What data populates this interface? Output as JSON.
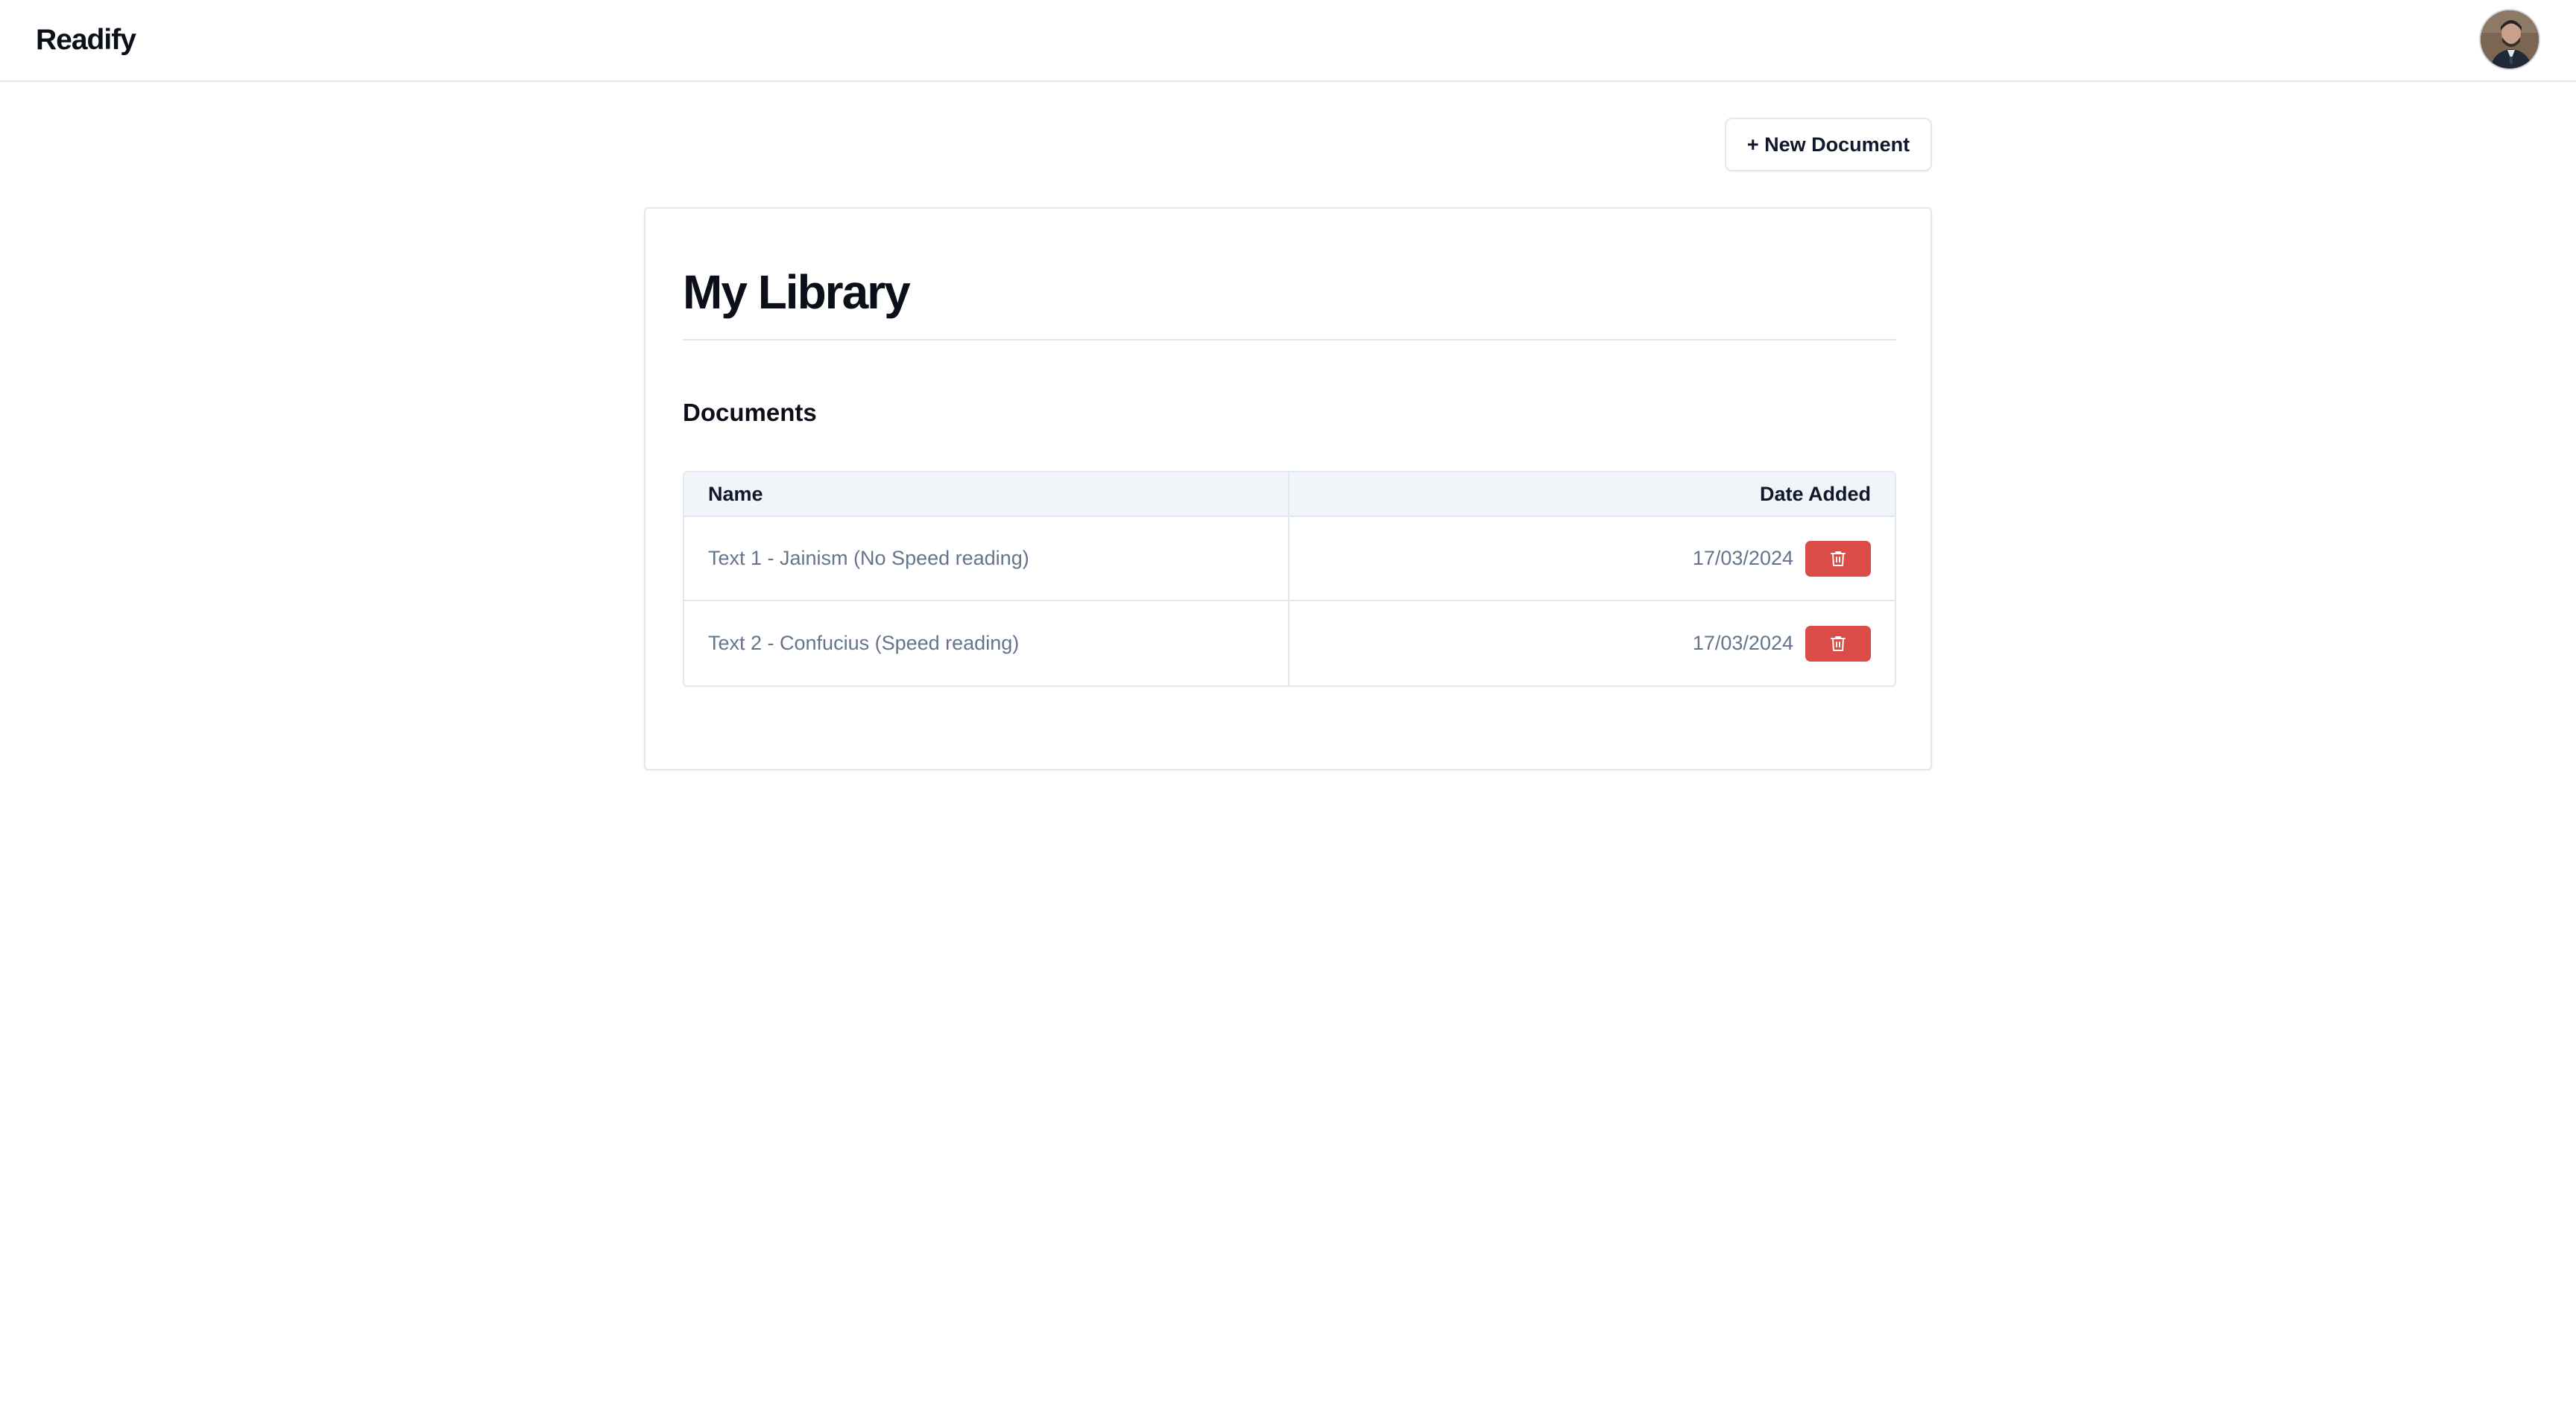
{
  "header": {
    "brand": "Readify",
    "avatar_icon": "user-avatar"
  },
  "toolbar": {
    "new_document_label": "+ New Document"
  },
  "library": {
    "title": "My Library",
    "section_heading": "Documents",
    "columns": [
      "Name",
      "Date Added"
    ],
    "rows": [
      {
        "name": "Text 1 - Jainism (No Speed reading)",
        "date": "17/03/2024",
        "action_icon": "trash-icon"
      },
      {
        "name": "Text 2 - Confucius (Speed reading)",
        "date": "17/03/2024",
        "action_icon": "trash-icon"
      }
    ]
  },
  "colors": {
    "delete_button": "#dc4c46",
    "header_row_bg": "#f1f5f9",
    "muted_text": "#64748b",
    "border": "#e2e8f0"
  }
}
